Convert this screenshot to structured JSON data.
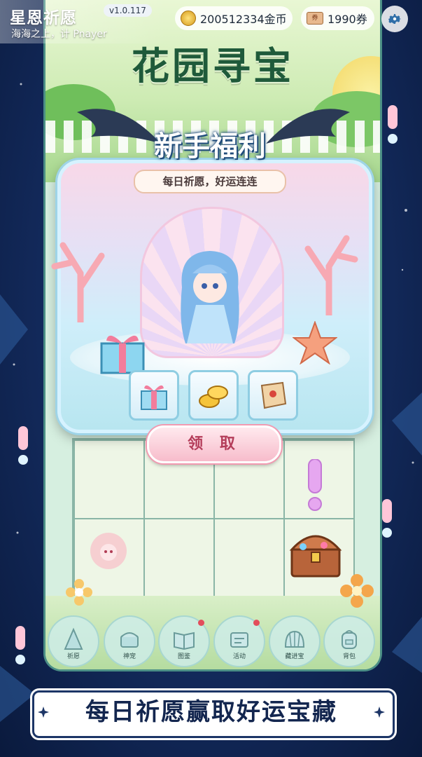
{
  "header": {
    "app_title": "星恩祈愿",
    "version": "v1.0.117",
    "subtitle": "海海之上，计 Pnayer",
    "gold_amount": "200512334金币",
    "ticket_amount": "1990券",
    "ticket_icon_text": "券"
  },
  "game": {
    "title": "花园寻宝"
  },
  "popup": {
    "title": "新手福利",
    "subtitle": "每日祈愿，好运连连",
    "rewards": [
      "gift-box-icon",
      "gold-coins-icon",
      "treasure-map-icon"
    ],
    "claim_label": "领 取"
  },
  "nav": {
    "items": [
      {
        "label": "祈愿",
        "icon": "wish-icon",
        "badge": false
      },
      {
        "label": "神宠",
        "icon": "pet-chest-icon",
        "badge": false
      },
      {
        "label": "图鉴",
        "icon": "book-icon",
        "badge": true
      },
      {
        "label": "活动",
        "icon": "event-icon",
        "badge": true
      },
      {
        "label": "藏进宝",
        "icon": "shell-icon",
        "badge": false
      },
      {
        "label": "背包",
        "icon": "backpack-icon",
        "badge": false
      }
    ]
  },
  "banner": {
    "text": "每日祈愿赢取好运宝藏"
  },
  "colors": {
    "accent": "#b43d5a",
    "frame": "#4b8f86",
    "background": "#132a5c",
    "title_green": "#1f5a3a"
  }
}
